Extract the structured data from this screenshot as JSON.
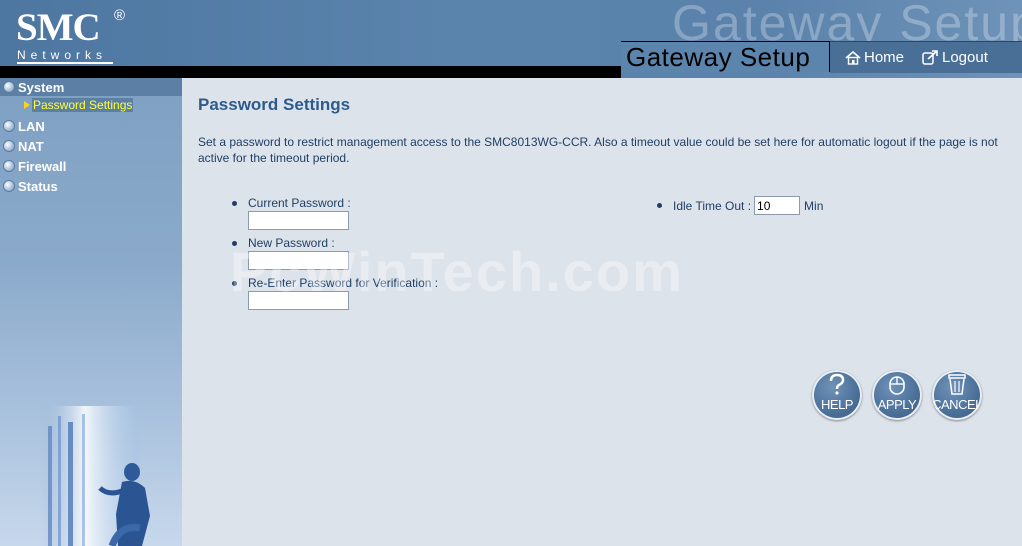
{
  "brand": {
    "logo": "SMC",
    "registered": "®",
    "subtitle": "Networks",
    "header_watermark": "Gateway Setup",
    "gateway_title": "Gateway  Setup"
  },
  "nav": {
    "home_label": "Home",
    "logout_label": "Logout"
  },
  "sidebar": {
    "items": [
      {
        "label": "System",
        "active": true
      },
      {
        "label": "LAN"
      },
      {
        "label": "NAT"
      },
      {
        "label": "Firewall"
      },
      {
        "label": "Status"
      }
    ],
    "submenu": {
      "label": "Password Settings"
    }
  },
  "main": {
    "title": "Password Settings",
    "description": "Set a password to restrict management access to the SMC8013WG-CCR. Also a timeout value could be set here for automatic logout if the page is not active for the timeout period.",
    "fields": {
      "current_password": {
        "label": "Current Password :",
        "value": ""
      },
      "new_password": {
        "label": "New Password :",
        "value": ""
      },
      "reenter_password": {
        "label": "Re-Enter Password for Verification :",
        "value": ""
      }
    },
    "idle": {
      "label": "Idle Time Out :",
      "value": "10",
      "unit": "Min"
    },
    "watermark": "PcWinTech.com"
  },
  "buttons": {
    "help": "HELP",
    "apply": "APPLY",
    "cancel": "CANCEL"
  },
  "colors": {
    "header": "#5b84ad",
    "sidebar": "#8baacb",
    "content_bg": "#dde3ea",
    "title": "#2d5c8c",
    "submenu_highlight": "#ffff33"
  }
}
